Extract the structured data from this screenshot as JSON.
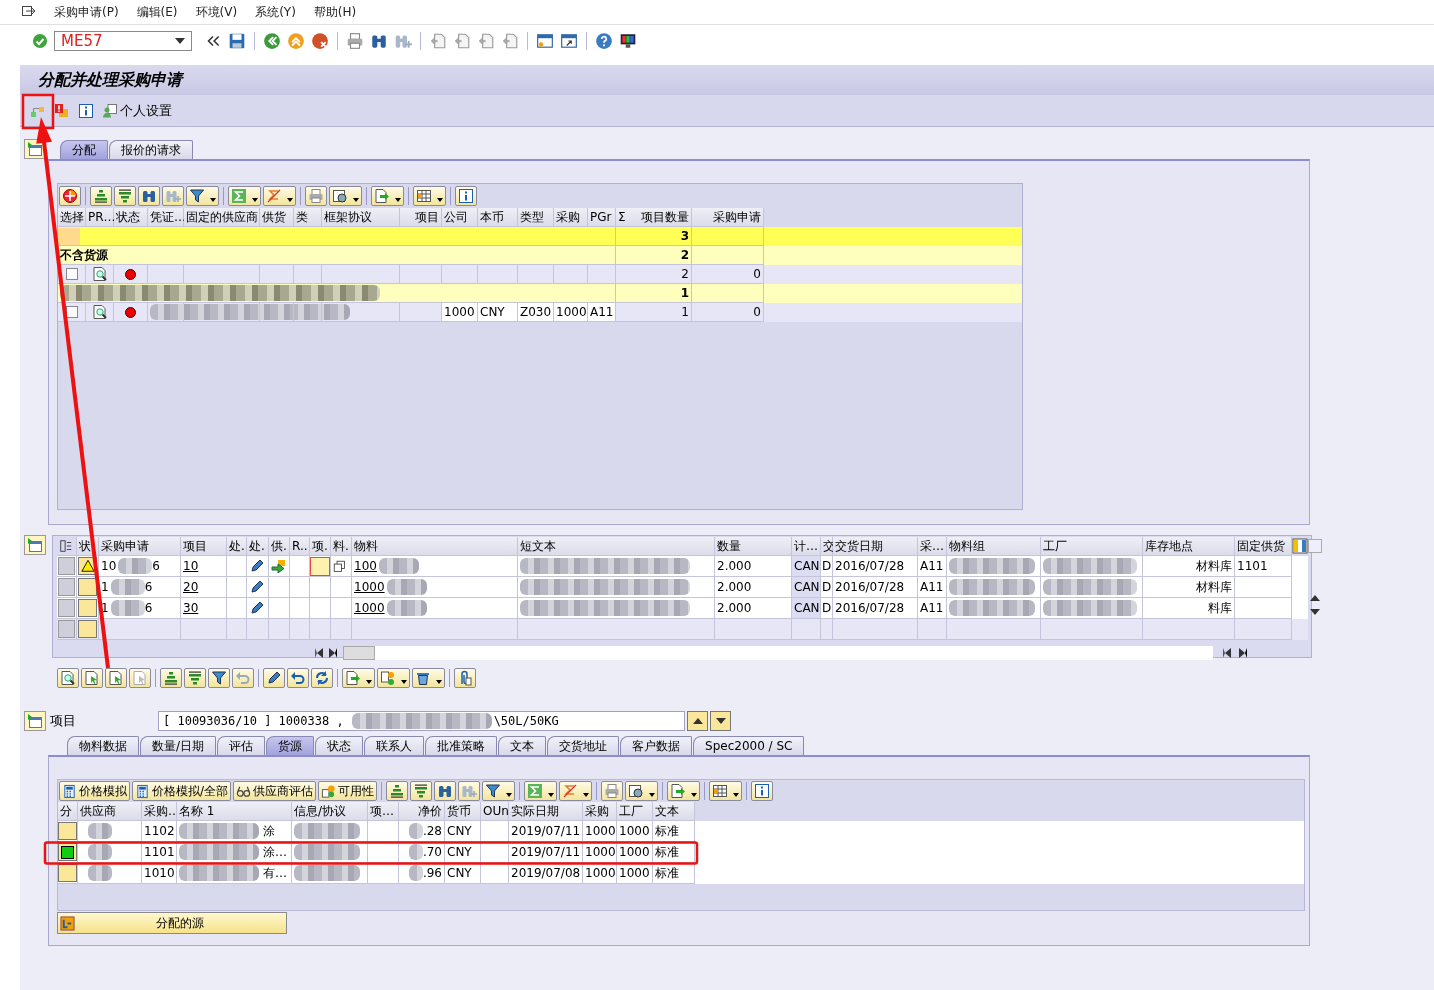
{
  "menu": [
    "采购申请(P)",
    "编辑(E)",
    "环境(V)",
    "系统(Y)",
    "帮助(H)"
  ],
  "command_field": {
    "value": "ME57"
  },
  "title": "分配并处理采购申请",
  "app_toolbar": {
    "settings_label": "个人设置"
  },
  "upper_tabs": [
    {
      "label": "分配",
      "selected": true
    },
    {
      "label": "报价的请求",
      "selected": false
    }
  ],
  "assignment_grid": {
    "columns": [
      {
        "label": "选择"
      },
      {
        "label": "PR…"
      },
      {
        "label": "状态"
      },
      {
        "label": "凭证…"
      },
      {
        "label": "固定的供应商"
      },
      {
        "label": "供货"
      },
      {
        "label": "类"
      },
      {
        "label": "框架协议"
      },
      {
        "label": "项目"
      },
      {
        "label": "公司"
      },
      {
        "label": "本币"
      },
      {
        "label": "类型"
      },
      {
        "label": "采购"
      },
      {
        "label": "PGr"
      },
      {
        "label": "项目数量",
        "sum_mark": "Σ"
      },
      {
        "label": "采购申请"
      }
    ],
    "rows": [
      {
        "kind": "total",
        "count": "3"
      },
      {
        "kind": "group",
        "label": "不含货源",
        "redacted": false,
        "count": "2"
      },
      {
        "kind": "item",
        "checked": false,
        "color": "#ee0000",
        "redacted": false,
        "count": "2",
        "requests": "0"
      },
      {
        "kind": "group",
        "redacted": true,
        "count": "1"
      },
      {
        "kind": "item",
        "checked": false,
        "color": "#ee0000",
        "redacted": true,
        "company": "1000",
        "currency": "CNY",
        "doc_type": "Z030",
        "purch_org": "1000",
        "purch_group": "A11",
        "count": "1",
        "requests": "0"
      }
    ]
  },
  "requisition_grid": {
    "columns": [
      {
        "label": "状"
      },
      {
        "label": "采购申请"
      },
      {
        "label": "项目"
      },
      {
        "label": "处."
      },
      {
        "label": "处."
      },
      {
        "label": "供."
      },
      {
        "label": "R.."
      },
      {
        "label": "项."
      },
      {
        "label": "料."
      },
      {
        "label": "物料"
      },
      {
        "label": "短文本"
      },
      {
        "label": "数量"
      },
      {
        "label": "计…"
      },
      {
        "label": "交"
      },
      {
        "label": "交货日期"
      },
      {
        "label": "采…"
      },
      {
        "label": "物料组"
      },
      {
        "label": "工厂"
      },
      {
        "label": "库存地点"
      },
      {
        "label": "固定供货"
      }
    ],
    "rows": [
      {
        "warning": true,
        "request_start": "10",
        "request_end": "6",
        "item": "10",
        "editable": true,
        "vendor_assigned": true,
        "marked": true,
        "material": "100",
        "quantity": "2.000",
        "unit": "CAN",
        "date_type": "D",
        "delivery_date": "2016/07/28",
        "purch_group": "A11",
        "storage": "材料库",
        "fixed_vendor": "1101"
      },
      {
        "warning": false,
        "request_start": "1",
        "request_end": "6",
        "item": "20",
        "editable": true,
        "vendor_assigned": false,
        "marked": false,
        "material": "1000",
        "quantity": "2.000",
        "unit": "CAN",
        "date_type": "D",
        "delivery_date": "2016/07/28",
        "purch_group": "A11",
        "storage": "材料库"
      },
      {
        "warning": false,
        "request_start": "1",
        "request_end": "6",
        "item": "30",
        "editable": true,
        "vendor_assigned": false,
        "marked": false,
        "material": "1000",
        "quantity": "2.000",
        "unit": "CAN",
        "date_type": "D",
        "delivery_date": "2016/07/28",
        "purch_group": "A11",
        "storage": "料库"
      }
    ]
  },
  "item_bar": {
    "label": "项目",
    "value_start": "[ 10093036/10 ] 1000338 ,",
    "value_end": "\\50L/50KG"
  },
  "detail_tabs": [
    {
      "label": "物料数据",
      "selected": false
    },
    {
      "label": "数量/日期",
      "selected": false
    },
    {
      "label": "评估",
      "selected": false
    },
    {
      "label": "货源",
      "selected": true
    },
    {
      "label": "状态",
      "selected": false
    },
    {
      "label": "联系人",
      "selected": false
    },
    {
      "label": "批准策略",
      "selected": false
    },
    {
      "label": "文本",
      "selected": false
    },
    {
      "label": "交货地址",
      "selected": false
    },
    {
      "label": "客户数据",
      "selected": false
    },
    {
      "label": "Spec2000 / SC",
      "selected": false
    }
  ],
  "source_toolbar": {
    "buttons": [
      {
        "kind": "calc",
        "label": "价格模拟"
      },
      {
        "kind": "calc",
        "label": "价格模拟/全部"
      },
      {
        "kind": "rating",
        "label": "供应商评估"
      },
      {
        "kind": "availability",
        "label": "可用性"
      }
    ]
  },
  "source_grid": {
    "columns": [
      {
        "label": "分"
      },
      {
        "label": "供应商"
      },
      {
        "label": "采购…"
      },
      {
        "label": "名称 1"
      },
      {
        "label": "信息/协议"
      },
      {
        "label": "项…"
      },
      {
        "label": "净价"
      },
      {
        "label": "货币"
      },
      {
        "label": "OUn"
      },
      {
        "label": "实际日期"
      },
      {
        "label": "采购"
      },
      {
        "label": "工厂"
      },
      {
        "label": "文本"
      }
    ],
    "rows": [
      {
        "assigned": false,
        "purch_org": "1102",
        "name": "涂",
        "net_price": ".28",
        "currency": "CNY",
        "date": "2019/07/11",
        "purch": "1000",
        "plant": "1000",
        "text": "标准"
      },
      {
        "assigned": true,
        "purch_org": "1101",
        "name": "涂…",
        "net_price": ".70",
        "currency": "CNY",
        "date": "2019/07/11",
        "purch": "1000",
        "plant": "1000",
        "text": "标准"
      },
      {
        "assigned": false,
        "purch_org": "1010",
        "name": "有…",
        "net_price": ".96",
        "currency": "CNY",
        "date": "2019/07/08",
        "purch": "1000",
        "plant": "1000",
        "text": "标准"
      }
    ]
  },
  "assign_button": {
    "label": "分配的源"
  }
}
